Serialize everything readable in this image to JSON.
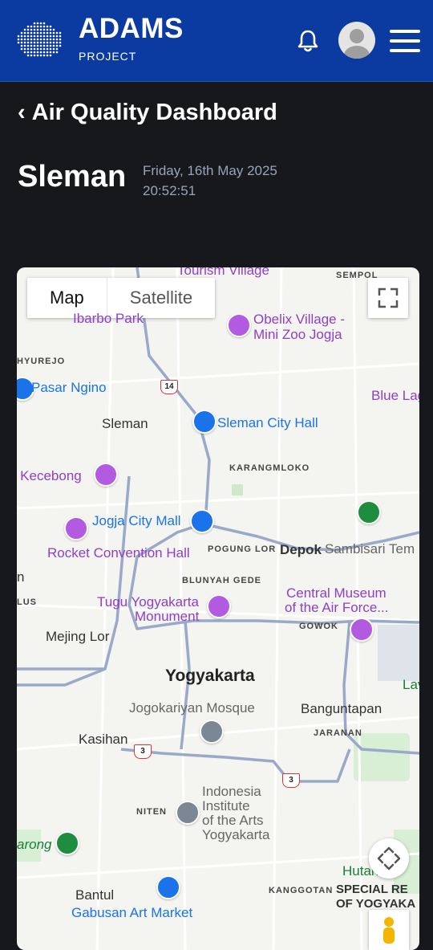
{
  "header": {
    "brand": "ADAMS",
    "brand_sub": "PROJECT"
  },
  "page": {
    "back_title": "Air Quality Dashboard",
    "city": "Sleman",
    "date": "Friday, 16th May 2025",
    "time": "20:52:51"
  },
  "map": {
    "type_buttons": [
      "Map",
      "Satellite"
    ],
    "labels": {
      "tourism_village": "Tourism Village",
      "sempol": "SEMPOL",
      "ibarbo_park": "Ibarbo Park",
      "obelix_1": "Obelix Village -",
      "obelix_2": "Mini Zoo Jogja",
      "hyurejo": "HYUREJO",
      "pasar_ngino": "Pasar Ngino",
      "blue_lagoon": "Blue Lag",
      "sleman": "Sleman",
      "sleman_city_hall": "Sleman City Hall",
      "route_14": "14",
      "karangmloko": "KARANGMLOKO",
      "kecebong": "h Kecebong",
      "jogja_city_mall": "Jogja City Mall",
      "rocket_hall": "Rocket Convention Hall",
      "pogung_lor": "POGUNG LOR",
      "depok": "Depok",
      "sambisari": "Sambisari Tem",
      "n_left": "n",
      "blunyah_gede": "BLUNYAH GEDE",
      "tugu_1": "Tugu Yogyakarta",
      "tugu_2": "Monument",
      "central_museum_1": "Central Museum",
      "central_museum_2": "of the Air Force...",
      "lus": "LUS",
      "gowok": "GOWOK",
      "mejing_lor": "Mejing Lor",
      "yogyakarta": "Yogyakarta",
      "lav": "Lav",
      "jogokariyan": "Jogokariyan Mosque",
      "banguntapan": "Banguntapan",
      "kasihan": "Kasihan",
      "jaranan": "JARANAN",
      "route_3a": "3",
      "route_3b": "3",
      "indonesia_1": "Indonesia",
      "indonesia_2": "Institute",
      "indonesia_3": "of the Arts",
      "indonesia_4": "Yogyakarta",
      "niten": "NITEN",
      "arong": "arong",
      "hutan": "Hutan Hu",
      "bantul": "Bantul",
      "kanggotan": "KANGGOTAN",
      "special_1": "SPECIAL RE",
      "special_2": "OF YOGYAKA",
      "gabusan": "Gabusan Art Market"
    }
  }
}
